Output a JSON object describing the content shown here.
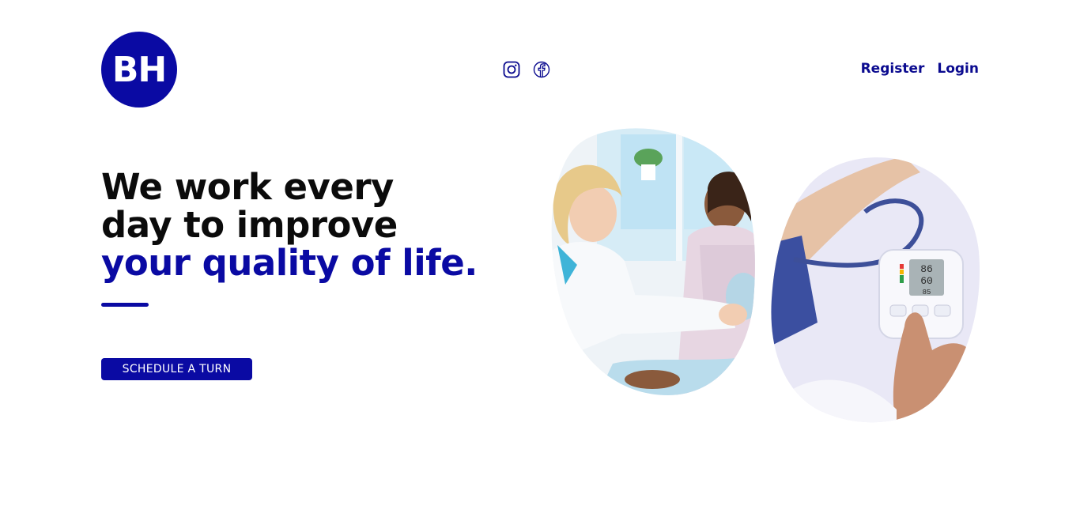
{
  "brand": {
    "logo_text": "BH",
    "accent_color": "#0a0aa3"
  },
  "header": {
    "social": [
      {
        "icon": "instagram-icon"
      },
      {
        "icon": "facebook-icon"
      }
    ],
    "auth": {
      "register_label": "Register",
      "login_label": "Login"
    }
  },
  "hero": {
    "title_line1": "We work every",
    "title_line2": "day to improve",
    "title_accent": "your quality of life.",
    "cta_label": "SCHEDULE A TURN"
  },
  "images": [
    {
      "name": "doctor-patient-photo"
    },
    {
      "name": "blood-pressure-monitor-photo"
    }
  ]
}
